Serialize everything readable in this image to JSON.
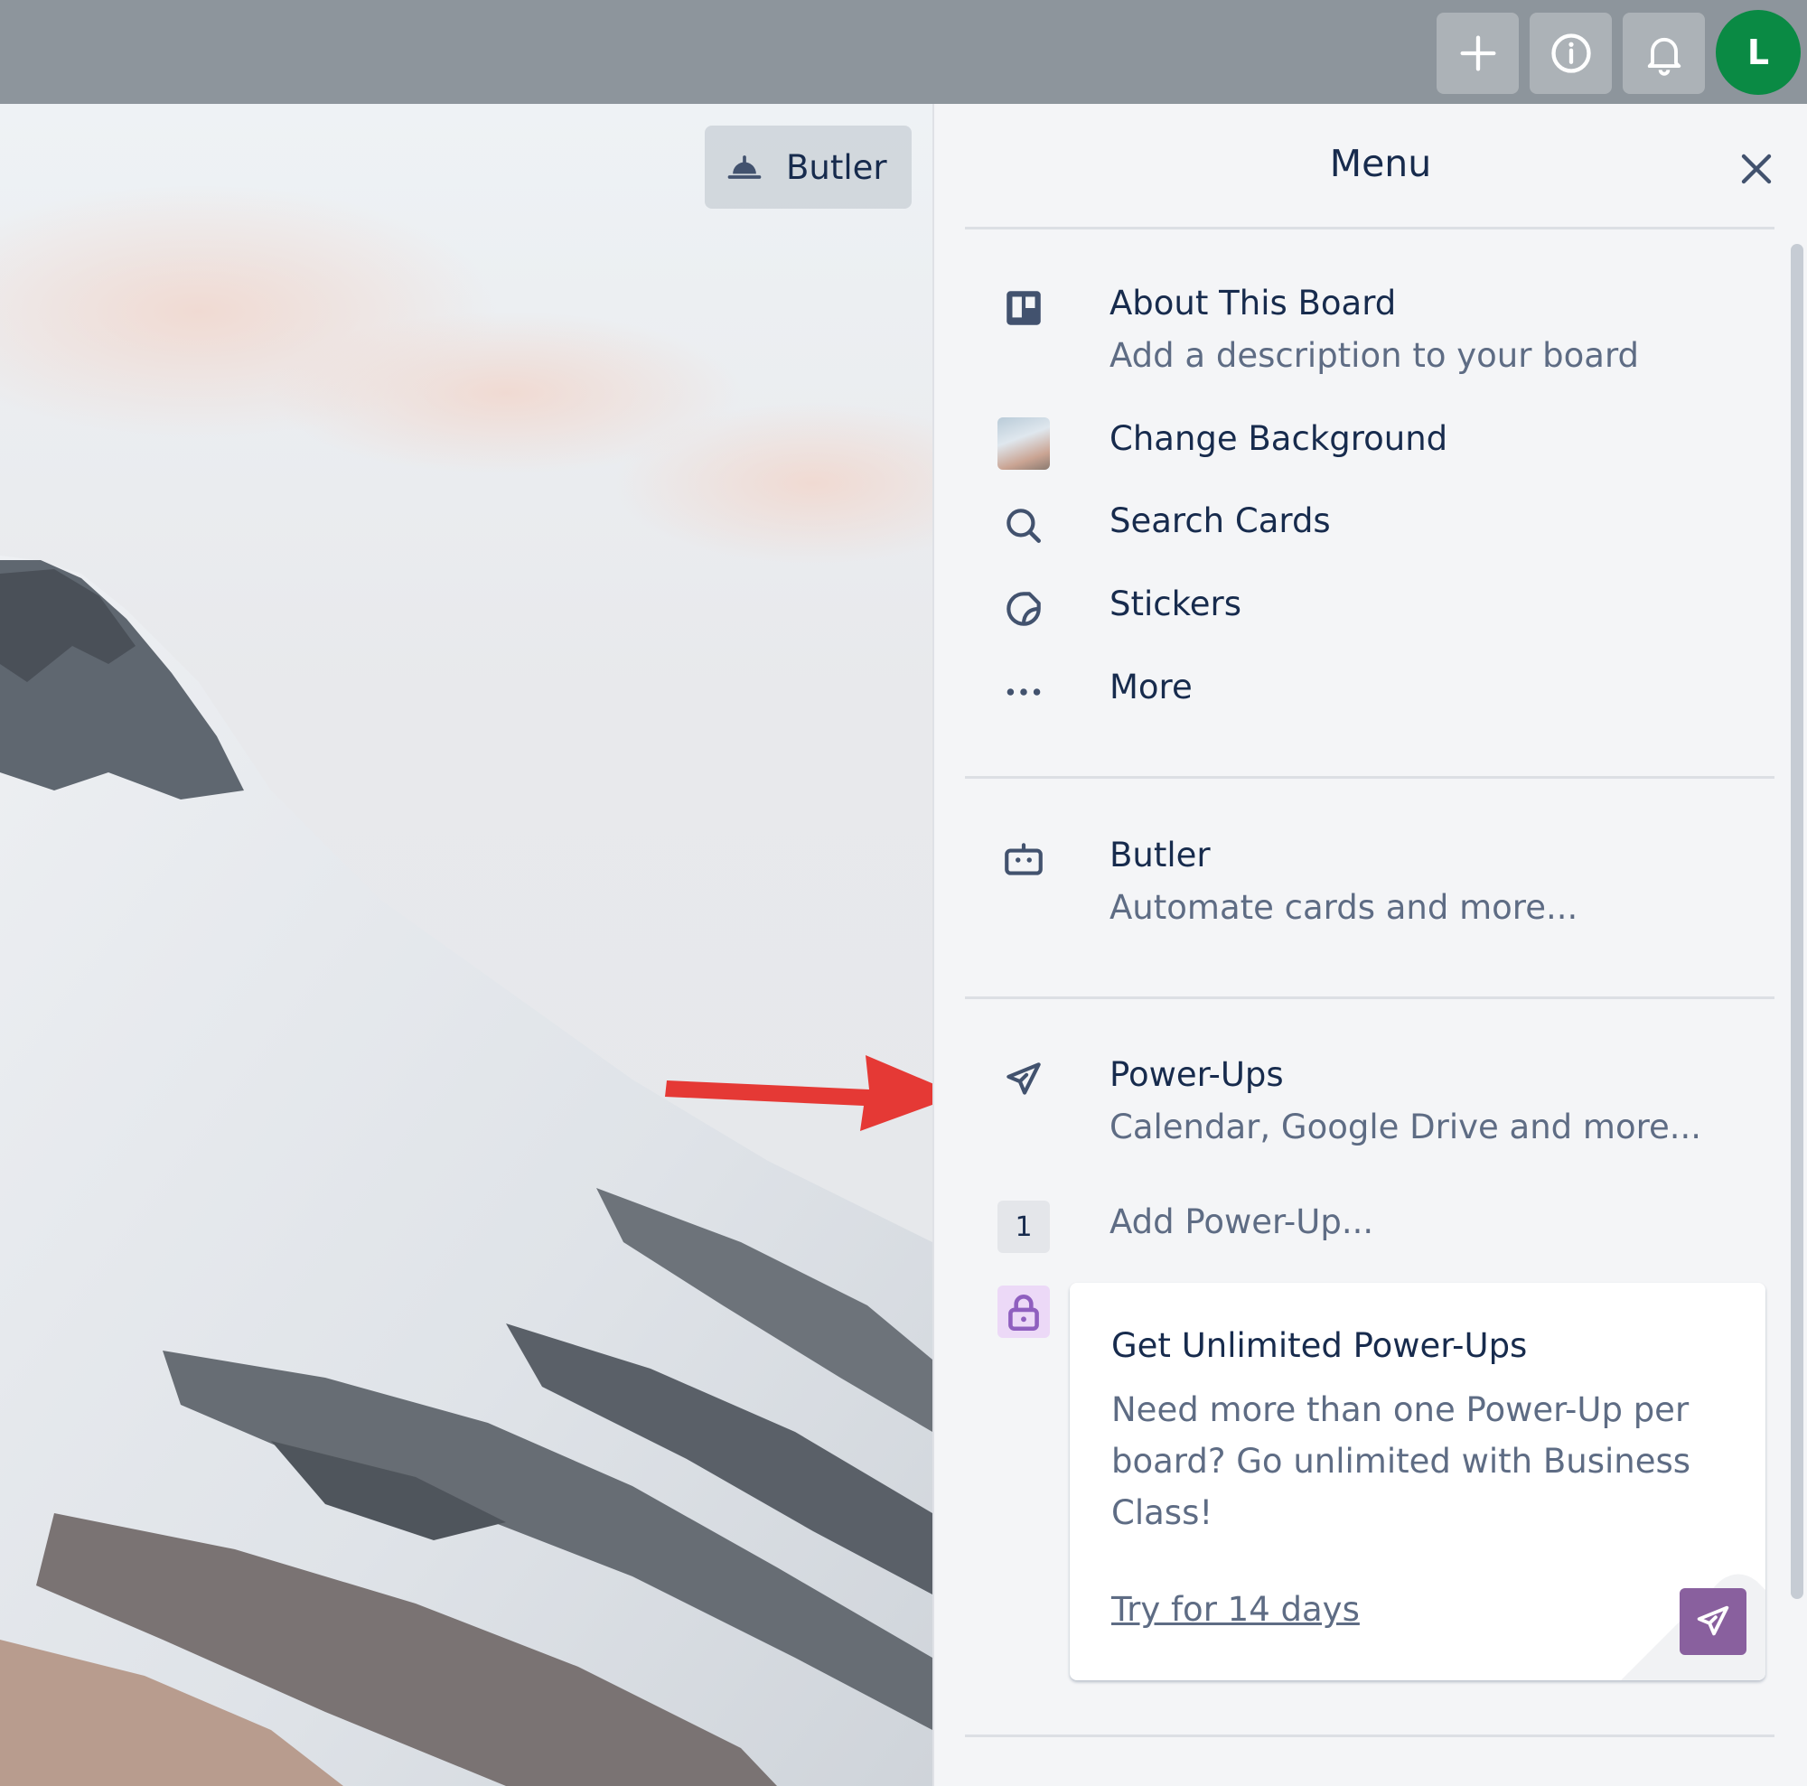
{
  "topbar": {
    "buttons": [
      {
        "name": "add",
        "icon": "plus-icon"
      },
      {
        "name": "info",
        "icon": "info-icon"
      },
      {
        "name": "notifications",
        "icon": "bell-icon"
      }
    ],
    "avatar_initial": "L",
    "avatar_color": "#0a8a44"
  },
  "board": {
    "butler_button_label": "Butler"
  },
  "menu": {
    "title": "Menu",
    "items": [
      {
        "label": "About This Board",
        "sublabel": "Add a description to your board",
        "icon": "board-icon"
      },
      {
        "label": "Change Background",
        "icon": "background-thumbnail"
      },
      {
        "label": "Search Cards",
        "icon": "search-icon"
      },
      {
        "label": "Stickers",
        "icon": "sticker-icon"
      },
      {
        "label": "More",
        "icon": "ellipsis-icon"
      }
    ],
    "butler": {
      "label": "Butler",
      "sublabel": "Automate cards and more...",
      "icon": "robot-icon"
    },
    "powerups": {
      "label": "Power-Ups",
      "sublabel": "Calendar, Google Drive and more...",
      "icon": "rocket-icon"
    },
    "add_powerup": {
      "count": "1",
      "label": "Add Power-Up..."
    },
    "promo": {
      "title": "Get Unlimited Power-Ups",
      "body": "Need more than one Power-Up per board? Go unlimited with Business Class!",
      "link": "Try for 14 days",
      "accent": "#89609e"
    }
  },
  "annotation_color": "#e53935"
}
